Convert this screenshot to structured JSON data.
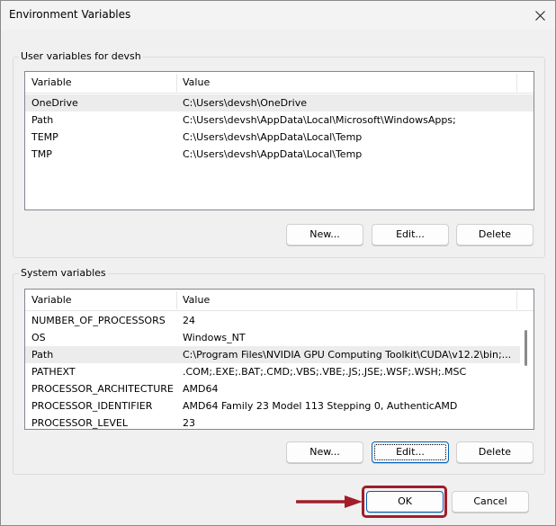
{
  "window": {
    "title": "Environment Variables"
  },
  "user_vars": {
    "group_label": "User variables for devsh",
    "columns": [
      "Variable",
      "Value"
    ],
    "rows": [
      {
        "variable": "OneDrive",
        "value": "C:\\Users\\devsh\\OneDrive",
        "selected": true
      },
      {
        "variable": "Path",
        "value": "C:\\Users\\devsh\\AppData\\Local\\Microsoft\\WindowsApps;",
        "selected": false
      },
      {
        "variable": "TEMP",
        "value": "C:\\Users\\devsh\\AppData\\Local\\Temp",
        "selected": false
      },
      {
        "variable": "TMP",
        "value": "C:\\Users\\devsh\\AppData\\Local\\Temp",
        "selected": false
      }
    ],
    "buttons": {
      "new": "New...",
      "edit": "Edit...",
      "delete": "Delete"
    }
  },
  "system_vars": {
    "group_label": "System variables",
    "columns": [
      "Variable",
      "Value"
    ],
    "rows": [
      {
        "variable": "NUMBER_OF_PROCESSORS",
        "value": "24",
        "selected": false
      },
      {
        "variable": "OS",
        "value": "Windows_NT",
        "selected": false
      },
      {
        "variable": "Path",
        "value": "C:\\Program Files\\NVIDIA GPU Computing Toolkit\\CUDA\\v12.2\\bin;...",
        "selected": true
      },
      {
        "variable": "PATHEXT",
        "value": ".COM;.EXE;.BAT;.CMD;.VBS;.VBE;.JS;.JSE;.WSF;.WSH;.MSC",
        "selected": false
      },
      {
        "variable": "PROCESSOR_ARCHITECTURE",
        "value": "AMD64",
        "selected": false
      },
      {
        "variable": "PROCESSOR_IDENTIFIER",
        "value": "AMD64 Family 23 Model 113 Stepping 0, AuthenticAMD",
        "selected": false
      },
      {
        "variable": "PROCESSOR_LEVEL",
        "value": "23",
        "selected": false
      }
    ],
    "buttons": {
      "new": "New...",
      "edit": "Edit...",
      "delete": "Delete"
    }
  },
  "footer": {
    "ok": "OK",
    "cancel": "Cancel"
  },
  "colors": {
    "highlight": "#a11d2b",
    "accent": "#005fb8"
  },
  "icons": {
    "close": "close-icon",
    "arrow": "red-arrow-icon"
  }
}
